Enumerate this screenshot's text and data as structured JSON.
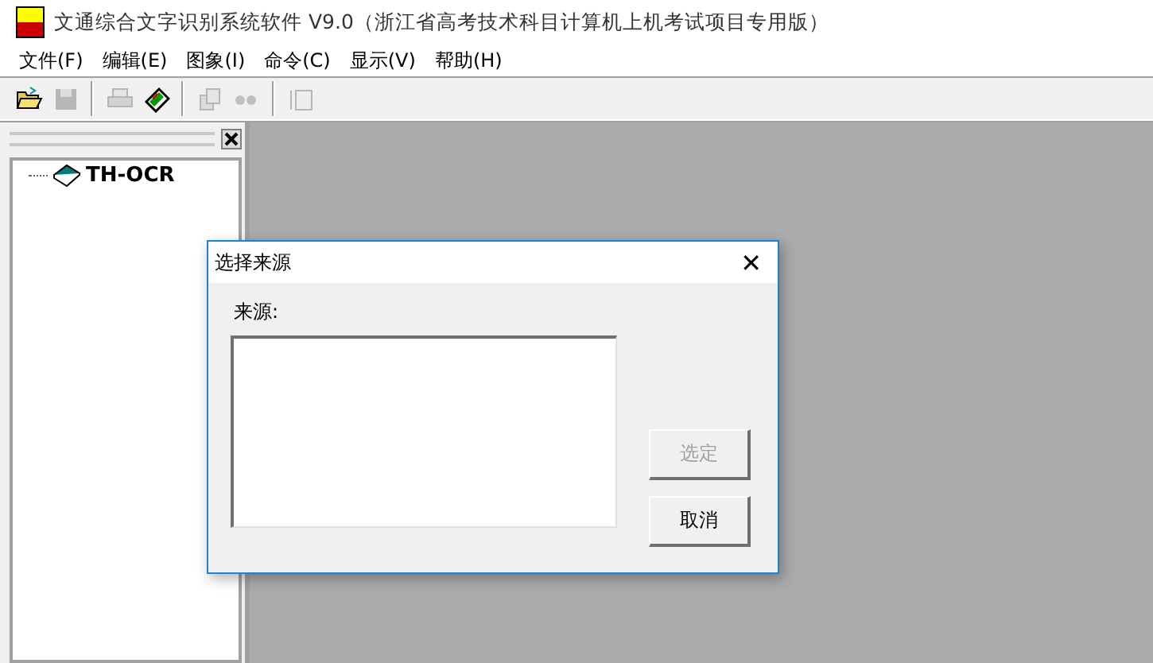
{
  "window": {
    "title": "文通综合文字识别系统软件 V9.0（浙江省高考技术科目计算机上机考试项目专用版）"
  },
  "menu": [
    "文件(F)",
    "编辑(E)",
    "图象(I)",
    "命令(C)",
    "显示(V)",
    "帮助(H)"
  ],
  "toolbar": [
    {
      "kind": "open",
      "disabled": false
    },
    {
      "kind": "save",
      "disabled": true
    },
    {
      "kind": "sep"
    },
    {
      "kind": "print",
      "disabled": true
    },
    {
      "kind": "scan",
      "disabled": false
    },
    {
      "kind": "sep"
    },
    {
      "kind": "batch",
      "disabled": true
    },
    {
      "kind": "dots",
      "disabled": true
    },
    {
      "kind": "sep"
    },
    {
      "kind": "pages",
      "disabled": true
    }
  ],
  "tree": {
    "items": [
      {
        "label": "TH-OCR"
      }
    ]
  },
  "dialog": {
    "title": "选择来源",
    "close": "✕",
    "label": "来源:",
    "buttons": [
      {
        "label": "选定",
        "disabled": true
      },
      {
        "label": "取消",
        "disabled": false
      }
    ]
  }
}
